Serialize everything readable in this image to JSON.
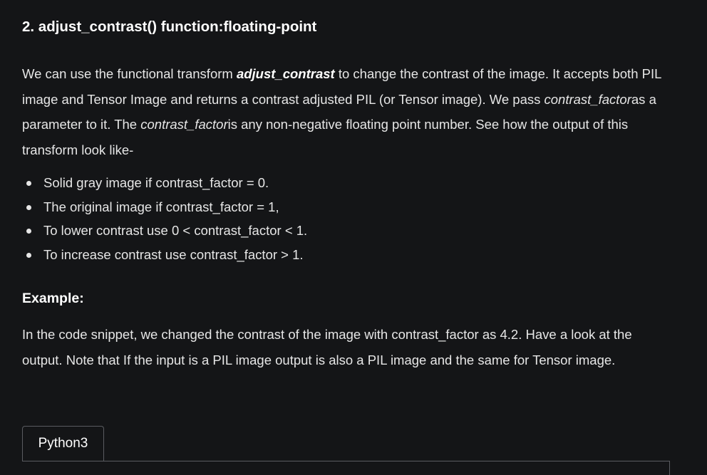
{
  "heading": "2. adjust_contrast() function:floating-point",
  "intro": {
    "t1": "We can use the functional transform ",
    "kw": "adjust_contrast",
    "t2": " to change the contrast of the image. It accepts both PIL image and Tensor Image and returns a contrast adjusted PIL (or Tensor image).  We pass ",
    "it1": "contrast_factor",
    "t3": "as a parameter to it. The ",
    "it2": "contrast_factor",
    "t4": "is any non-negative floating point number. See how the output of this transform look like-"
  },
  "bullets": [
    "Solid gray image if contrast_factor = 0.",
    "The original image if contrast_factor = 1,",
    "To lower contrast use 0 < contrast_factor < 1.",
    "To increase contrast use contrast_factor > 1."
  ],
  "example_heading": "Example:",
  "example_text": "In the code snippet, we changed the contrast of the image with contrast_factor as 4.2. Have a look at the output. Note that If the input is a PIL image output is also a PIL image and the same for Tensor image.",
  "code_tab_label": "Python3"
}
